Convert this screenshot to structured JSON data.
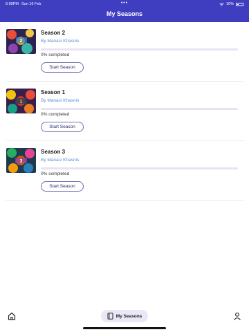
{
  "status_bar": {
    "time": "6:09PM",
    "date": "Sun 16 Feb",
    "dots": "•••",
    "battery": "16%"
  },
  "header": {
    "title": "My Seasons"
  },
  "seasons": [
    {
      "title": "Season 2",
      "author": "By Manasi Khasnis",
      "progress": 0,
      "progress_text": "0% completed",
      "button": "Start Season"
    },
    {
      "title": "Season 1",
      "author": "By Manasi Khasnis",
      "progress": 0,
      "progress_text": "0% completed",
      "button": "Start Season"
    },
    {
      "title": "Season 3",
      "author": "By Manasi Khasnis",
      "progress": 0,
      "progress_text": "0% completed",
      "button": "Start Season"
    }
  ],
  "tab_bar": {
    "items": [
      {
        "icon": "home-icon"
      },
      {
        "icon": "book-icon",
        "label": "My Seasons",
        "active": true
      },
      {
        "icon": "profile-icon"
      }
    ]
  },
  "colors": {
    "header": "#3f3ec0",
    "author": "#5b8fd6",
    "tab_active_bg": "#e9e8f6",
    "progress_track": "#e7e3f4"
  }
}
